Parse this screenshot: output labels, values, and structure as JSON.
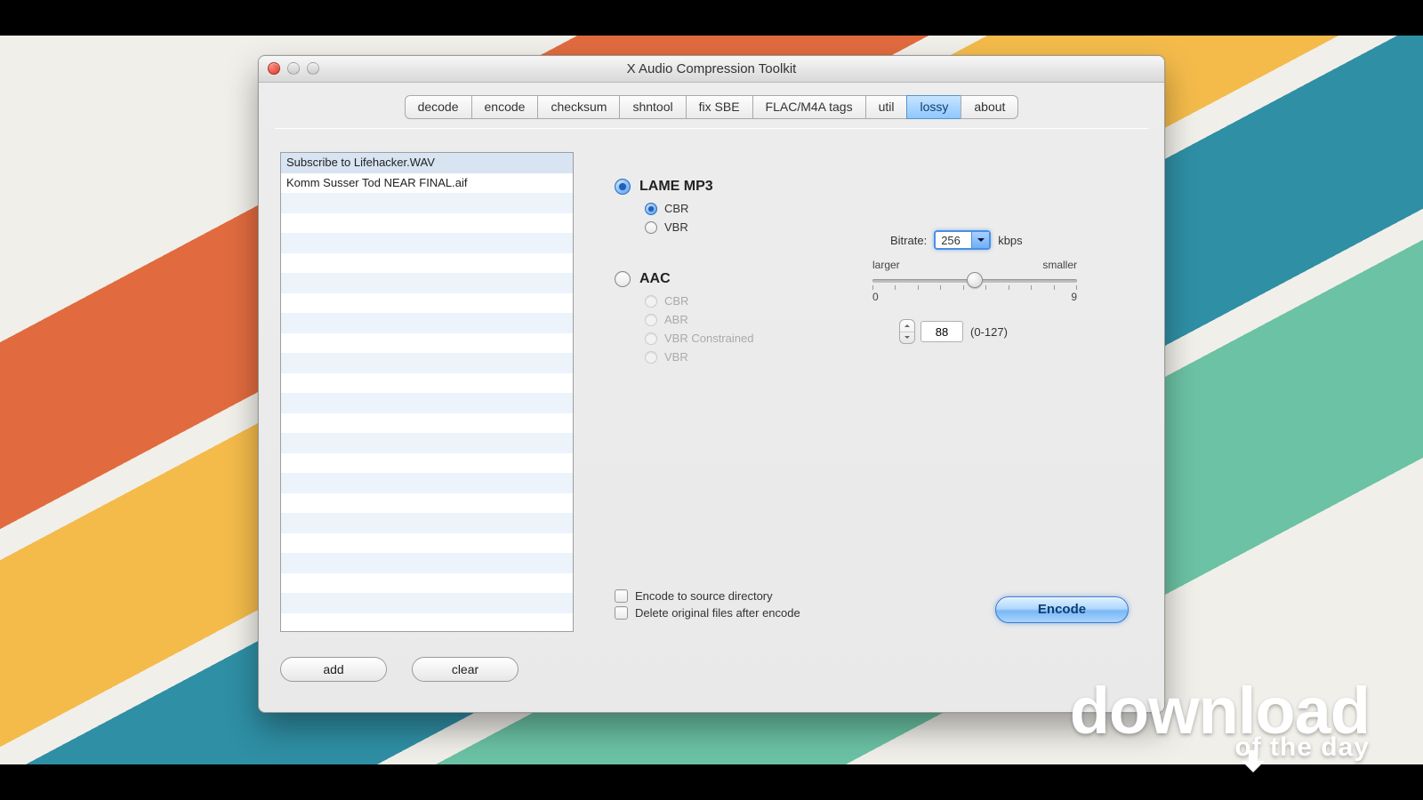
{
  "window": {
    "title": "X Audio Compression Toolkit"
  },
  "tabs": {
    "items": [
      "decode",
      "encode",
      "checksum",
      "shntool",
      "fix SBE",
      "FLAC/M4A tags",
      "util",
      "lossy",
      "about"
    ],
    "active_index": 7
  },
  "filelist": {
    "items": [
      "Subscribe to Lifehacker.WAV",
      "Komm Susser Tod NEAR FINAL.aif"
    ],
    "selected_index": 0,
    "buttons": {
      "add": "add",
      "clear": "clear"
    }
  },
  "encoder": {
    "lame": {
      "label": "LAME MP3",
      "selected": true,
      "modes": {
        "cbr": "CBR",
        "vbr": "VBR",
        "selected": "cbr"
      }
    },
    "aac": {
      "label": "AAC",
      "selected": false,
      "modes": {
        "cbr": "CBR",
        "abr": "ABR",
        "vbr_constrained": "VBR Constrained",
        "vbr": "VBR"
      }
    }
  },
  "bitrate": {
    "label": "Bitrate:",
    "value": "256",
    "unit": "kbps",
    "slider": {
      "left_label": "larger",
      "right_label": "smaller",
      "min_label": "0",
      "max_label": "9",
      "pos_pct": 50
    }
  },
  "quality": {
    "value": "88",
    "range_label": "(0-127)"
  },
  "options": {
    "encode_to_source": {
      "label": "Encode to source directory",
      "checked": false
    },
    "delete_original": {
      "label": "Delete original files after encode",
      "checked": false
    }
  },
  "actions": {
    "encode": "Encode"
  },
  "watermark": {
    "line1": "download",
    "line2": "of the day"
  }
}
